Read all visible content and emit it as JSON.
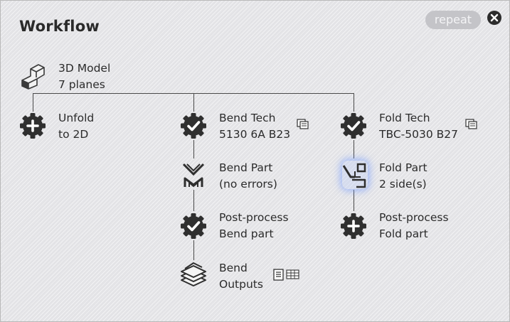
{
  "panel": {
    "title": "Workflow",
    "repeat_label": "repeat"
  },
  "nodes": {
    "model": {
      "line1": "3D Model",
      "line2": "7 planes",
      "icon": "3d-model-icon"
    },
    "unfold": {
      "line1": "Unfold",
      "line2": "to 2D",
      "icon": "plus-gear-icon"
    },
    "bend_tech": {
      "line1": "Bend Tech",
      "line2": "5130 6A B23",
      "icon": "check-gear-icon"
    },
    "bend_part": {
      "line1": "Bend Part",
      "line2": "(no errors)",
      "icon": "bend-tool-icon"
    },
    "post_bend": {
      "line1": "Post-process",
      "line2": "Bend part",
      "icon": "check-gear-icon"
    },
    "bend_outputs": {
      "line1": "Bend",
      "line2": "Outputs",
      "icon": "stack-layers-icon"
    },
    "fold_tech": {
      "line1": "Fold Tech",
      "line2": "TBC-5030 B27",
      "icon": "check-gear-icon"
    },
    "fold_part": {
      "line1": "Fold Part",
      "line2": "2 side(s)",
      "icon": "fold-tool-icon"
    },
    "post_fold": {
      "line1": "Post-process",
      "line2": "Fold part",
      "icon": "plus-gear-icon"
    }
  },
  "colors": {
    "icon_dark": "#2f2f2f",
    "line": "#4a4a4a",
    "highlight": "#6e96ff",
    "repeat_bg": "#c4c4c8"
  }
}
